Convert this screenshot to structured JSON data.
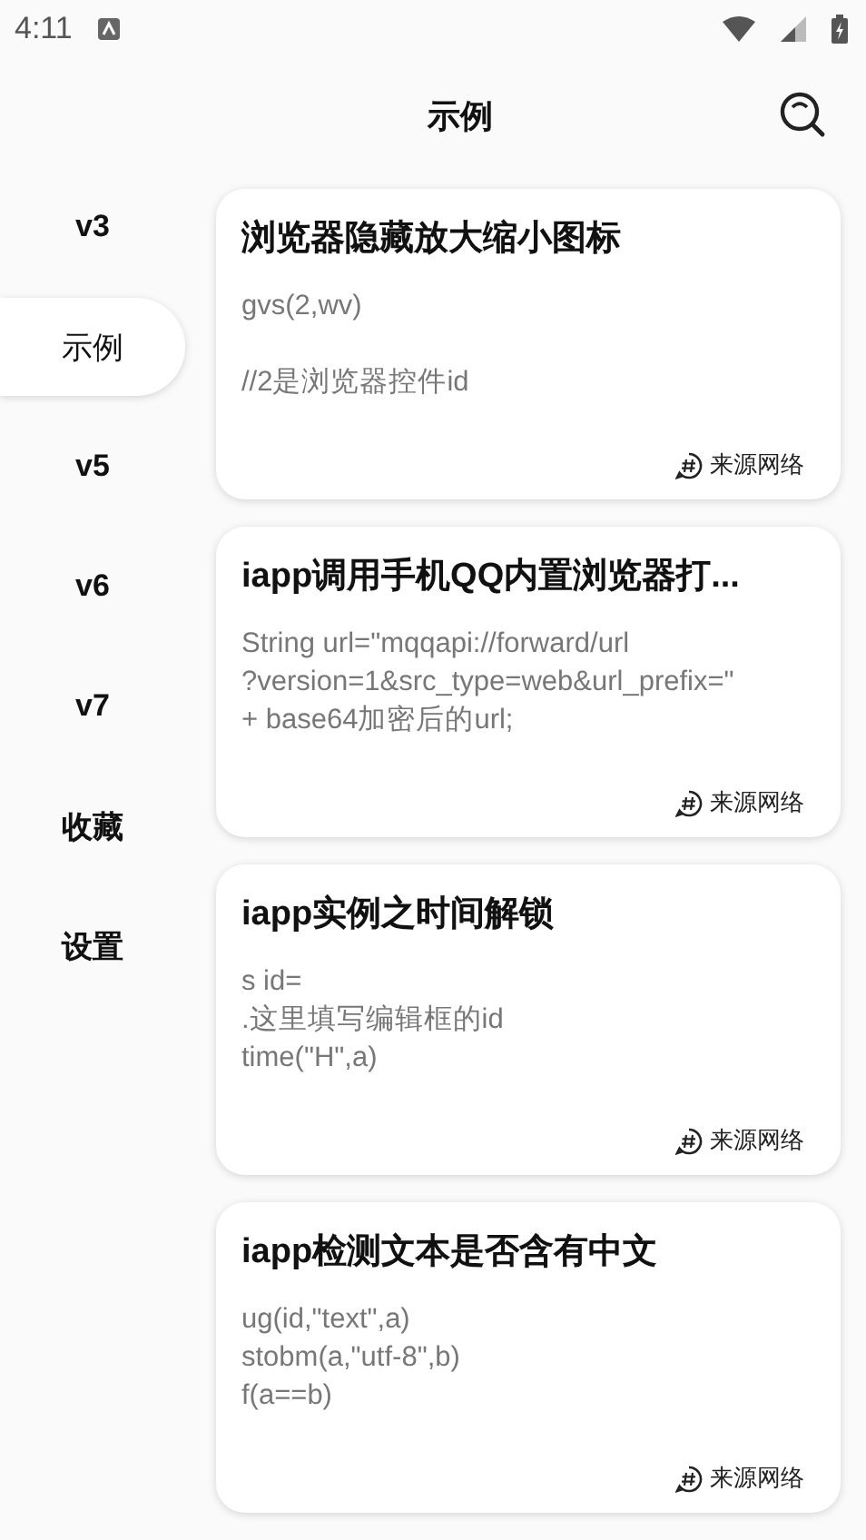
{
  "status_bar": {
    "time": "4:11"
  },
  "header": {
    "title": "示例"
  },
  "sidebar": {
    "items": [
      {
        "label": "v3",
        "selected": false
      },
      {
        "label": "示例",
        "selected": true
      },
      {
        "label": "v5",
        "selected": false
      },
      {
        "label": "v6",
        "selected": false
      },
      {
        "label": "v7",
        "selected": false
      },
      {
        "label": "收藏",
        "selected": false
      },
      {
        "label": "设置",
        "selected": false
      }
    ]
  },
  "cards": [
    {
      "title": "浏览器隐藏放大缩小图标",
      "body": "gvs(2,wv)\n\n//2是浏览器控件id",
      "source": "来源网络"
    },
    {
      "title": "iapp调用手机QQ内置浏览器打...",
      "body": "String url=\"mqqapi://forward/url\n?version=1&src_type=web&url_prefix=\"\n+ base64加密后的url;",
      "source": "来源网络"
    },
    {
      "title": "iapp实例之时间解锁",
      "body": "s id=\n.这里填写编辑框的id\ntime(\"H\",a)",
      "source": "来源网络"
    },
    {
      "title": "iapp检测文本是否含有中文",
      "body": "ug(id,\"text\",a)\nstobm(a,\"utf-8\",b)\nf(a==b)",
      "source": "来源网络"
    }
  ]
}
